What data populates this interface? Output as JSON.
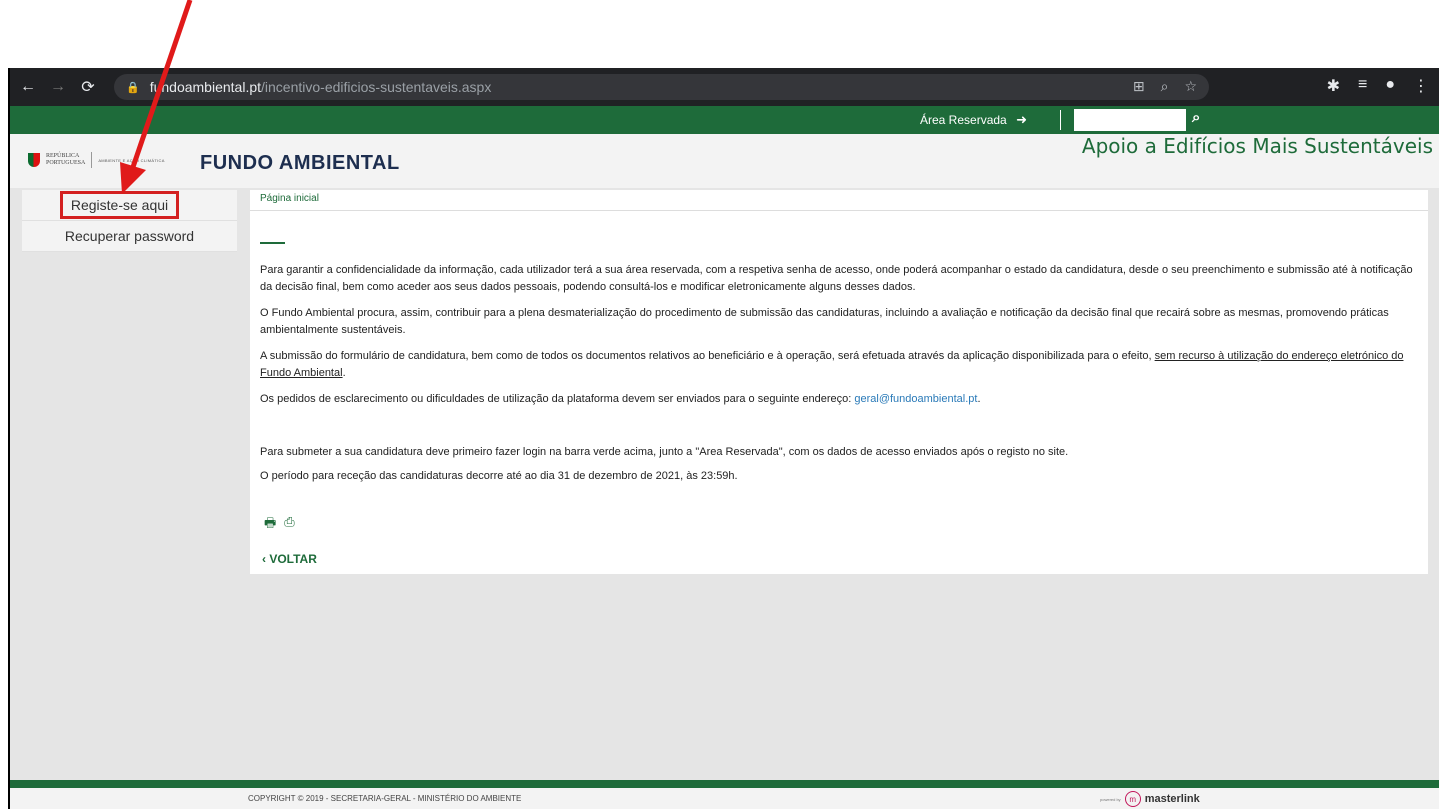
{
  "browser": {
    "url_host": "fundoambiental.pt",
    "url_path": "/incentivo-edificios-sustentaveis.aspx"
  },
  "topbar": {
    "area_reservada": "Área Reservada",
    "search_placeholder": ""
  },
  "header": {
    "rp_logo_text_1": "REPÚBLICA",
    "rp_logo_text_2": "PORTUGUESA",
    "rp_ministry": "AMBIENTE E AÇÃO CLIMÁTICA",
    "brand": "FUNDO AMBIENTAL",
    "page_heading": "Apoio a Edifícios Mais Sustentáveis"
  },
  "sidebar": {
    "items": [
      {
        "label": "Registe-se aqui"
      },
      {
        "label": "Recuperar password"
      }
    ]
  },
  "content": {
    "breadcrumb": "Página inicial",
    "p1": "Para garantir a confidencialidade da informação, cada utilizador terá a sua área reservada, com a respetiva senha de acesso, onde poderá acompanhar o estado da candidatura, desde o seu preenchimento e submissão até à notificação da decisão final, bem como aceder aos seus dados pessoais, podendo consultá-los e modificar eletronicamente alguns desses dados.",
    "p2": "O Fundo Ambiental procura, assim, contribuir para a plena desmaterialização do procedimento de submissão das candidaturas, incluindo a avaliação e notificação da decisão final que recairá sobre as mesmas, promovendo práticas ambientalmente sustentáveis.",
    "p3_start": "A submissão do formulário de candidatura, bem como de todos os documentos relativos ao beneficiário e à operação, será efetuada através da aplicação disponibilizada para o efeito, ",
    "p3_underlined": "sem recurso à utilização do endereço eletrónico do Fundo Ambiental",
    "p3_end": ".",
    "p4_start": "Os pedidos de esclarecimento ou dificuldades de utilização da plataforma devem ser enviados para o seguinte endereço: ",
    "p4_email": "geral@fundoambiental.pt",
    "p4_end": ".",
    "p5": "Para submeter a sua candidatura deve primeiro fazer login na barra verde acima, junto a \"Area Reservada\", com os dados de acesso enviados após o registo no site.",
    "p6": "O período para receção das candidaturas decorre até ao dia 31 de dezembro de 2021, às 23:59h.",
    "voltar": "VOLTAR"
  },
  "footer": {
    "copyright": "COPYRIGHT © 2019 - SECRETARIA-GERAL - MINISTÉRIO DO AMBIENTE",
    "powered": "powered by",
    "brand": "masterlink"
  },
  "colors": {
    "green": "#1e6b3a",
    "annotation_red": "#e01a1a"
  }
}
